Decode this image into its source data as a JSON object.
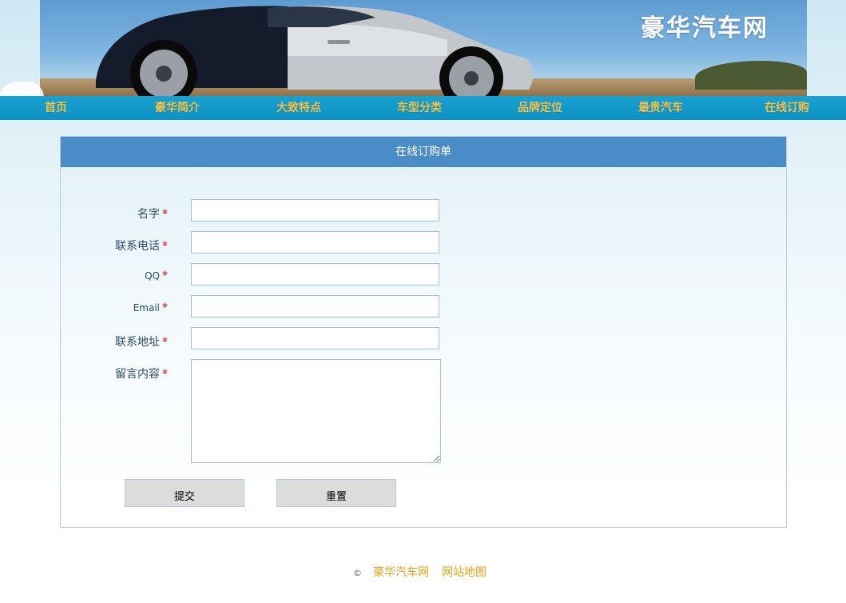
{
  "site": {
    "logo_text": "豪华汽车网"
  },
  "nav": [
    {
      "label": "首页"
    },
    {
      "label": "豪华简介"
    },
    {
      "label": "大致特点"
    },
    {
      "label": "车型分类"
    },
    {
      "label": "品牌定位"
    },
    {
      "label": "最贵汽车"
    },
    {
      "label": "在线订购"
    }
  ],
  "form": {
    "title": "在线订购单",
    "required_mark": "*",
    "fields": [
      {
        "label": "名字",
        "value": ""
      },
      {
        "label": "联系电话",
        "value": ""
      },
      {
        "label": "QQ",
        "value": ""
      },
      {
        "label": "Email",
        "value": ""
      },
      {
        "label": "联系地址",
        "value": ""
      },
      {
        "label": "留言内容",
        "value": ""
      }
    ],
    "submit_label": "提交",
    "reset_label": "重置"
  },
  "footer": {
    "copyright_symbol": "©",
    "links": [
      {
        "label": "豪华汽车网"
      },
      {
        "label": "网站地图"
      }
    ]
  },
  "colors": {
    "nav_background": "#0b92c4",
    "nav_text": "#f0c24a",
    "panel_header": "#4a8cc8",
    "required": "#e00000",
    "footer_link": "#e6a21a"
  }
}
